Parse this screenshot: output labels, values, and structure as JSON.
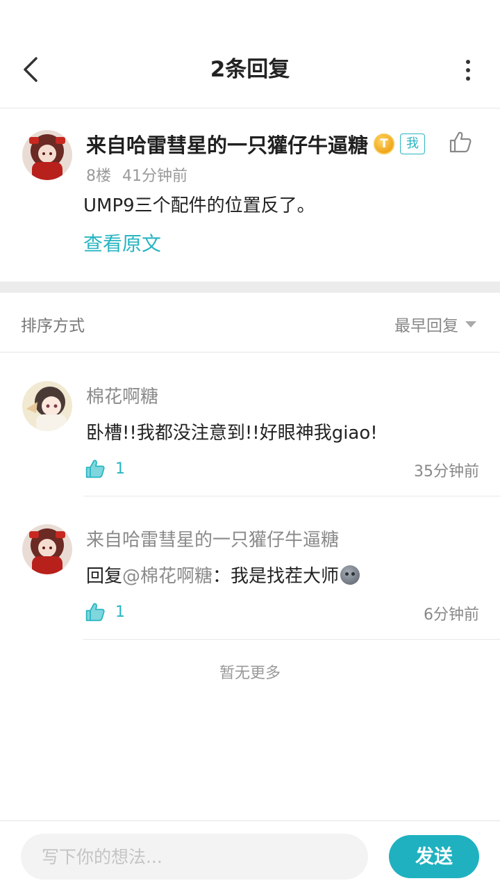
{
  "header": {
    "title": "2条回复",
    "back_icon": "chevron-left-icon",
    "more_icon": "more-vertical-icon"
  },
  "main_post": {
    "author": "来自哈雷彗星的一只獾仔牛逼糖",
    "coin_badge": "T",
    "me_badge": "我",
    "floor": "8楼",
    "time": "41分钟前",
    "text": "UMP9三个配件的位置反了。",
    "view_original": "查看原文"
  },
  "sort": {
    "label": "排序方式",
    "selected": "最早回复"
  },
  "replies": [
    {
      "author": "棉花啊糖",
      "text": "卧槽!!我都没注意到!!好眼神我giao!",
      "likes": "1",
      "time": "35分钟前"
    },
    {
      "author": "来自哈雷彗星的一只獾仔牛逼糖",
      "reply_prefix": "回复",
      "mention": "@棉花啊糖",
      "text": "：我是找茬大师",
      "likes": "1",
      "time": "6分钟前"
    }
  ],
  "no_more": "暂无更多",
  "composer": {
    "placeholder": "写下你的想法...",
    "send_label": "发送"
  },
  "colors": {
    "accent": "#28b5c2",
    "send_button": "#1fb1c0",
    "divider": "#e8e8e8"
  }
}
